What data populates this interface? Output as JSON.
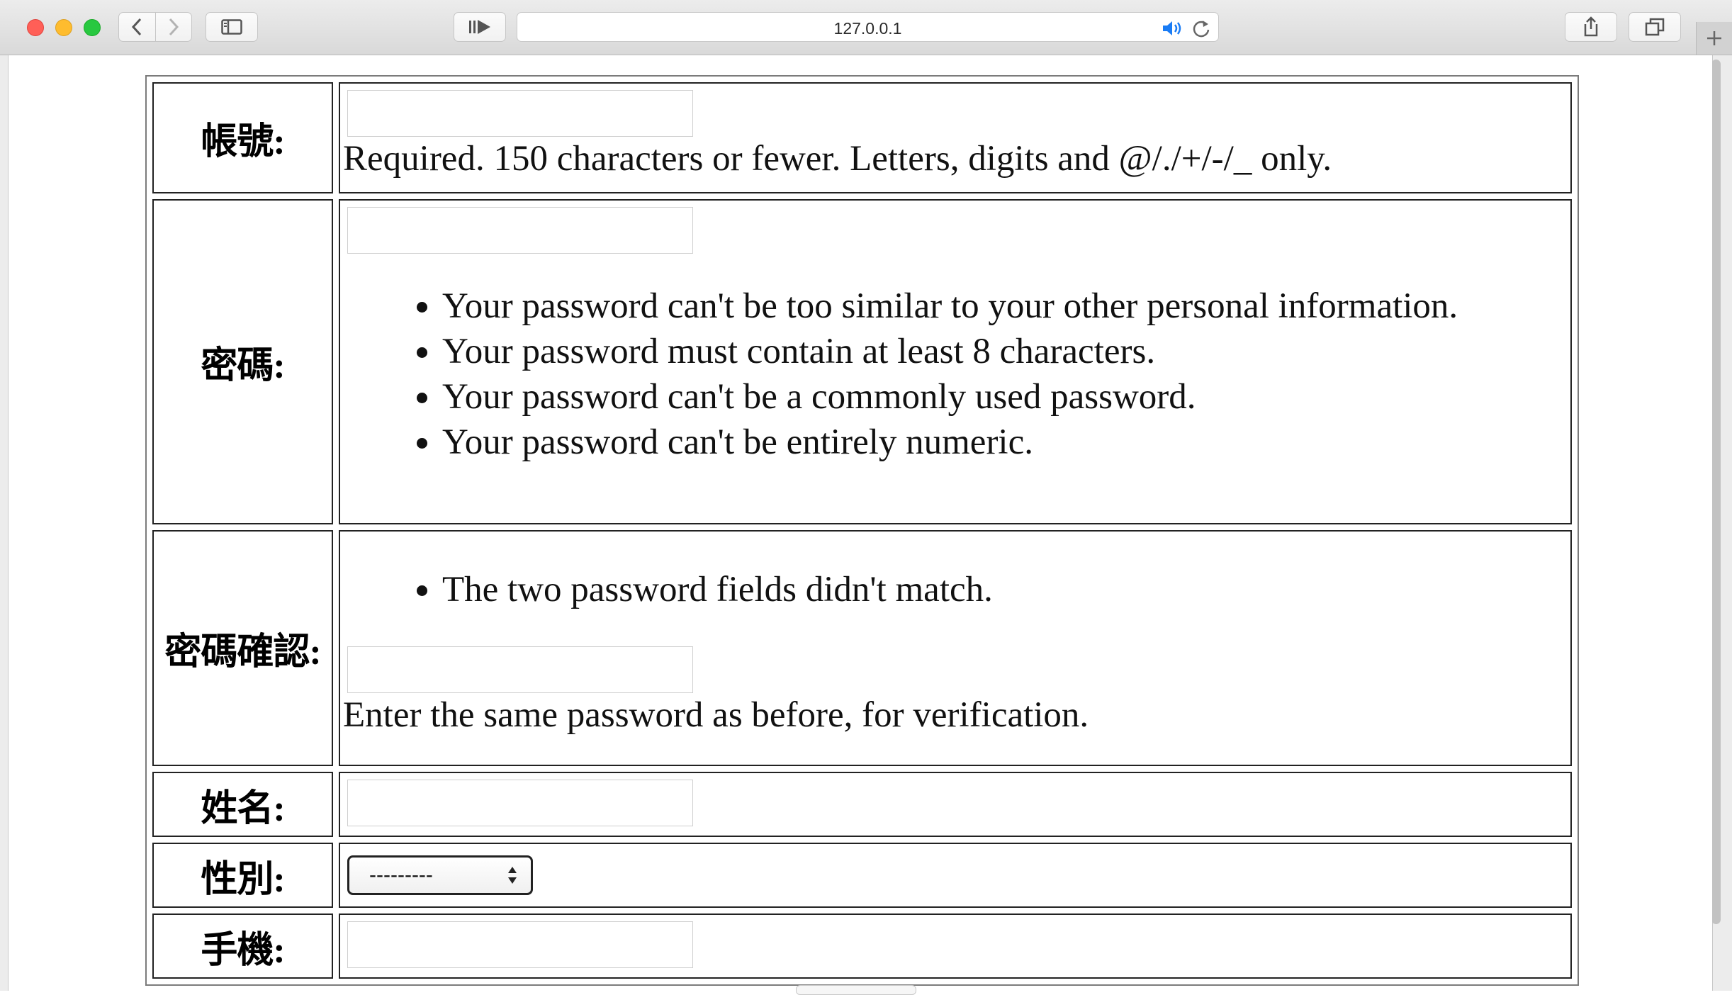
{
  "browser": {
    "url": "127.0.0.1",
    "icons": {
      "back": "chevron-left-icon",
      "forward": "chevron-right-icon",
      "sidebar": "sidebar-icon",
      "reader": "reader-icon",
      "audio": "speaker-icon",
      "reload": "reload-icon",
      "share": "share-icon",
      "tabs": "tabs-icon",
      "new_tab": "plus-icon"
    },
    "traffic_lights": [
      "#ff5f57",
      "#febc2e",
      "#28c840"
    ],
    "audio_color": "#1a7cf5"
  },
  "form": {
    "username": {
      "label": "帳號:",
      "value": "",
      "help": "Required. 150 characters or fewer. Letters, digits and @/./+/-/_ only."
    },
    "password": {
      "label": "密碼:",
      "value": "",
      "rules": [
        "Your password can't be too similar to your other personal information.",
        "Your password must contain at least 8 characters.",
        "Your password can't be a commonly used password.",
        "Your password can't be entirely numeric."
      ]
    },
    "password_confirm": {
      "label": "密碼確認:",
      "errors": [
        "The two password fields didn't match."
      ],
      "value": "",
      "help": "Enter the same password as before, for verification."
    },
    "name": {
      "label": "姓名:",
      "value": ""
    },
    "gender": {
      "label": "性別:",
      "selected": "---------"
    },
    "phone": {
      "label": "手機:",
      "value": ""
    }
  }
}
